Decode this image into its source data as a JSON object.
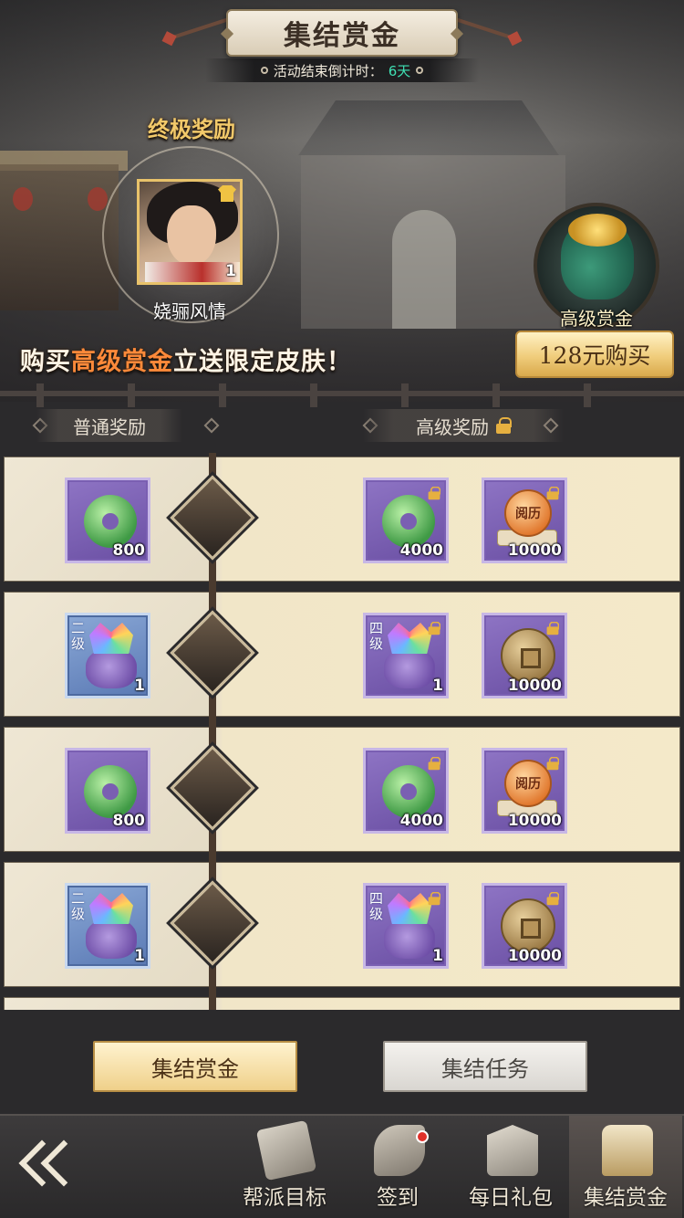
{
  "header": {
    "title": "集结赏金",
    "countdown_label": "活动结束倒计时：",
    "countdown_value": "6天"
  },
  "ultimate": {
    "title": "终极奖励",
    "skin_name": "娆骊风情",
    "skin_qty": "1"
  },
  "promo": {
    "prefix": "购买",
    "highlight": "高级赏金",
    "suffix": "立送限定皮肤！"
  },
  "advanced": {
    "label": "高级赏金",
    "buy_label": "128元购买"
  },
  "tabs": {
    "normal": "普通奖励",
    "advanced": "高级奖励"
  },
  "rows": [
    {
      "normal": {
        "icon": "jade-ring-icon",
        "qty": "800"
      },
      "adv1": {
        "icon": "jade-ring-icon",
        "qty": "4000"
      },
      "adv2": {
        "icon": "experience-orb-icon",
        "label": "阅历",
        "qty": "10000"
      }
    },
    {
      "normal": {
        "icon": "gem-bag-icon",
        "grade": "二级",
        "qty": "1"
      },
      "adv1": {
        "icon": "gem-bag-icon",
        "grade": "四级",
        "qty": "1"
      },
      "adv2": {
        "icon": "copper-coin-icon",
        "qty": "10000"
      }
    },
    {
      "normal": {
        "icon": "jade-ring-icon",
        "qty": "800"
      },
      "adv1": {
        "icon": "jade-ring-icon",
        "qty": "4000"
      },
      "adv2": {
        "icon": "experience-orb-icon",
        "label": "阅历",
        "qty": "10000"
      }
    },
    {
      "normal": {
        "icon": "gem-bag-icon",
        "grade": "二级",
        "qty": "1"
      },
      "adv1": {
        "icon": "gem-bag-icon",
        "grade": "四级",
        "qty": "1"
      },
      "adv2": {
        "icon": "copper-coin-icon",
        "qty": "10000"
      }
    }
  ],
  "buttons": {
    "rally": "集结赏金",
    "tasks": "集结任务"
  },
  "nav": [
    {
      "label": "帮派目标",
      "icon": "book-icon"
    },
    {
      "label": "签到",
      "icon": "scroll-icon",
      "badge": true
    },
    {
      "label": "每日礼包",
      "icon": "gift-icon"
    },
    {
      "label": "集结赏金",
      "icon": "chest-icon",
      "active": true
    }
  ],
  "colors": {
    "accent_gold": "#f0cd7c",
    "promo_highlight": "#ff8a3a",
    "countdown_days": "#3fe0b4",
    "item_purple": "#6a4fa3",
    "item_blue": "#5a79b4"
  }
}
